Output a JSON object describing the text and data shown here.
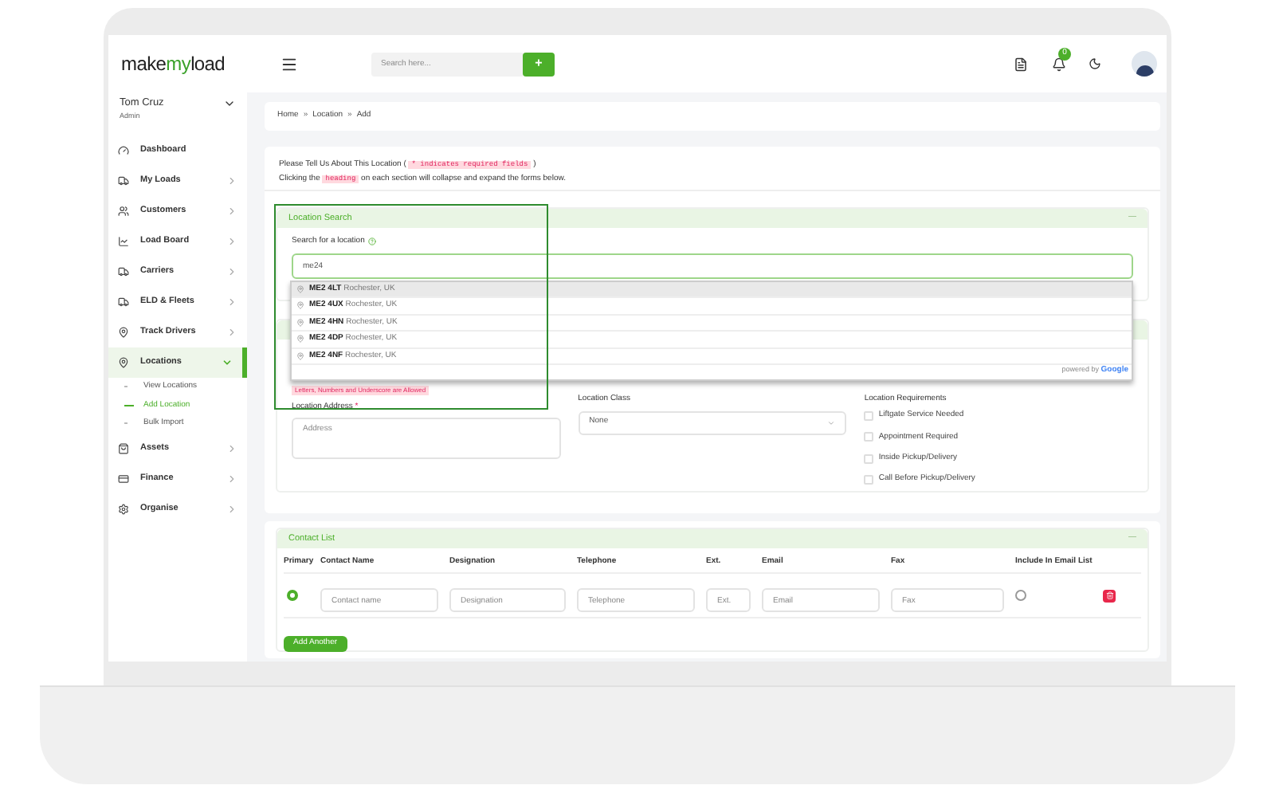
{
  "logo": {
    "parts": [
      {
        "text": "make",
        "accent": false
      },
      {
        "text": "my",
        "accent": true
      },
      {
        "text": "load",
        "accent": false
      }
    ]
  },
  "header": {
    "search": {
      "placeholder": "Search here..."
    },
    "add_button": "+",
    "notification_count": "0"
  },
  "user": {
    "name": "Tom Cruz",
    "role": "Admin"
  },
  "sidebar": {
    "items": [
      {
        "label": "Dashboard",
        "has_submenu": false,
        "expanded": false,
        "selected": false
      },
      {
        "label": "My Loads",
        "has_submenu": true,
        "expanded": false,
        "selected": false
      },
      {
        "label": "Customers",
        "has_submenu": true,
        "expanded": false,
        "selected": false
      },
      {
        "label": "Load Board",
        "has_submenu": true,
        "expanded": false,
        "selected": false
      },
      {
        "label": "Carriers",
        "has_submenu": true,
        "expanded": false,
        "selected": false
      },
      {
        "label": "ELD & Fleets",
        "has_submenu": true,
        "expanded": false,
        "selected": false
      },
      {
        "label": "Track Drivers",
        "has_submenu": true,
        "expanded": false,
        "selected": false
      },
      {
        "label": "Locations",
        "has_submenu": true,
        "expanded": true,
        "selected": true,
        "children": [
          {
            "label": "View Locations",
            "selected": false
          },
          {
            "label": "Add Location",
            "selected": true
          },
          {
            "label": "Bulk Import",
            "selected": false
          }
        ]
      },
      {
        "label": "Assets",
        "has_submenu": true,
        "expanded": false,
        "selected": false
      },
      {
        "label": "Finance",
        "has_submenu": true,
        "expanded": false,
        "selected": false
      },
      {
        "label": "Organise",
        "has_submenu": true,
        "expanded": false,
        "selected": false
      }
    ]
  },
  "breadcrumb": {
    "separator": "»",
    "items": [
      "Home",
      "Location",
      "Add"
    ]
  },
  "intro": {
    "line_1": {
      "before": "Please Tell Us About This Location (",
      "badge": "* indicates required fields",
      "after": ")"
    },
    "line_2": {
      "before": "Clicking the",
      "badge": "heading",
      "after": "on each section will collapse and expand the forms below."
    }
  },
  "location_search": {
    "title": "Location Search",
    "collapse": "—",
    "label": "Search for a location",
    "value": "me24",
    "suggestions": [
      {
        "code": "ME2 4LT",
        "place": "Rochester, UK",
        "selected": true
      },
      {
        "code": "ME2 4UX",
        "place": "Rochester, UK",
        "selected": false
      },
      {
        "code": "ME2 4HN",
        "place": "Rochester, UK",
        "selected": false
      },
      {
        "code": "ME2 4DP",
        "place": "Rochester, UK",
        "selected": false
      },
      {
        "code": "ME2 4NF",
        "place": "Rochester, UK",
        "selected": false
      }
    ],
    "powered_by": "powered by",
    "attribution": "Google"
  },
  "details": {
    "error": "Letters, Numbers and Underscore are Allowed",
    "address": {
      "label": "Location Address",
      "required_mark": "*",
      "placeholder": "Address"
    },
    "location_class": {
      "label": "Location Class",
      "value": "None"
    },
    "requirements": {
      "label": "Location Requirements",
      "options": [
        {
          "label": "Liftgate Service Needed",
          "checked": false
        },
        {
          "label": "Appointment Required",
          "checked": false
        },
        {
          "label": "Inside Pickup/Delivery",
          "checked": false
        },
        {
          "label": "Call Before Pickup/Delivery",
          "checked": false
        }
      ]
    }
  },
  "contacts": {
    "title": "Contact List",
    "collapse": "—",
    "columns": [
      "Primary",
      "Contact Name",
      "Designation",
      "Telephone",
      "Ext.",
      "Email",
      "Fax",
      "Include In Email List"
    ],
    "rows": [
      {
        "primary": true,
        "placeholders": [
          "Contact name",
          "Designation",
          "Telephone",
          "Ext.",
          "Email",
          "Fax"
        ],
        "include_in_email": false
      }
    ],
    "add_button": "Add Another"
  }
}
